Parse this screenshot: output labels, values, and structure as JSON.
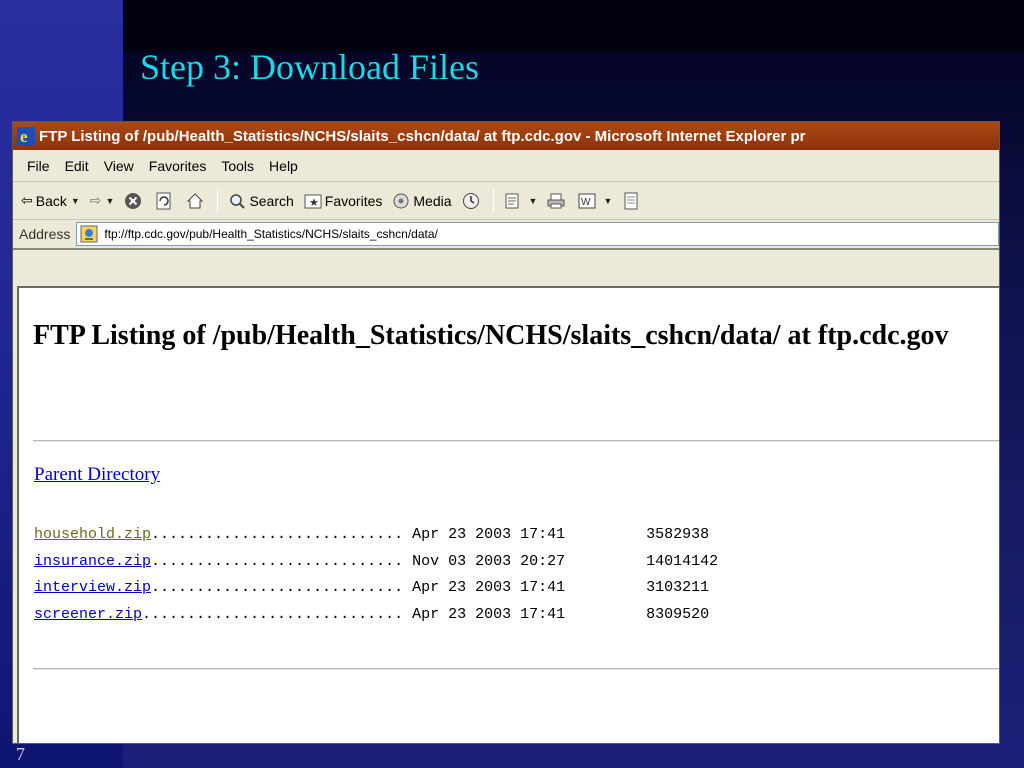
{
  "slide": {
    "title": "Step 3: Download Files",
    "number": "7"
  },
  "window": {
    "title": "FTP Listing of /pub/Health_Statistics/NCHS/slaits_cshcn/data/ at ftp.cdc.gov - Microsoft Internet Explorer pr"
  },
  "menu": [
    "File",
    "Edit",
    "View",
    "Favorites",
    "Tools",
    "Help"
  ],
  "toolbar": {
    "back": "Back",
    "search": "Search",
    "favorites": "Favorites",
    "media": "Media"
  },
  "address": {
    "label": "Address",
    "url": "ftp://ftp.cdc.gov/pub/Health_Statistics/NCHS/slaits_cshcn/data/"
  },
  "page": {
    "heading": "FTP Listing of /pub/Health_Statistics/NCHS/slaits_cshcn/data/ at ftp.cdc.gov",
    "parent_link": "Parent Directory",
    "files": [
      {
        "name": "household.zip",
        "dots": "............................ ",
        "date": "Apr 23 2003 17:41",
        "size": "3582938",
        "visited": true
      },
      {
        "name": "insurance.zip",
        "dots": "............................ ",
        "date": "Nov 03 2003 20:27",
        "size": "14014142",
        "visited": false
      },
      {
        "name": "interview.zip",
        "dots": "............................ ",
        "date": "Apr 23 2003 17:41",
        "size": "3103211",
        "visited": false
      },
      {
        "name": "screener.zip",
        "dots": "............................. ",
        "date": "Apr 23 2003 17:41",
        "size": "8309520",
        "visited": false
      }
    ]
  },
  "colors": {
    "slide_title": "#19d8e8",
    "link": "#0000cc",
    "visited_link": "#6b6b1a",
    "titlebar": "#9a3b0d"
  }
}
